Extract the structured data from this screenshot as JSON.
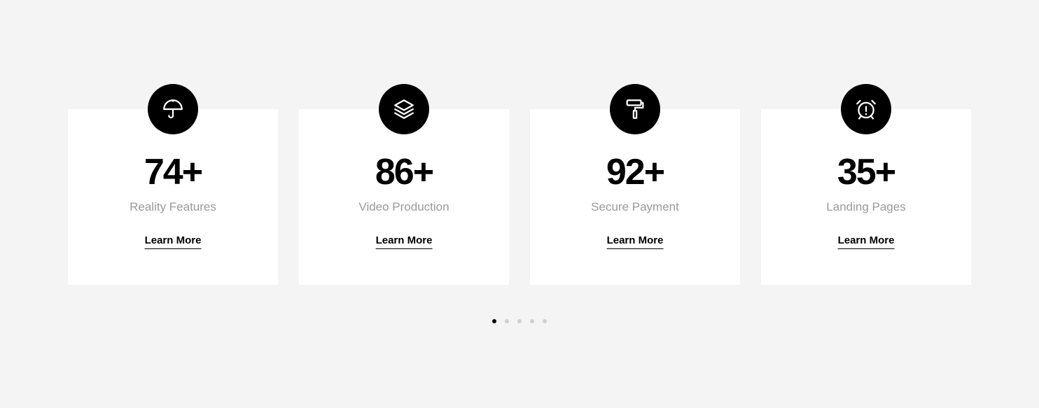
{
  "features": [
    {
      "icon": "umbrella-icon",
      "number": "74+",
      "label": "Reality Features",
      "link": "Learn More"
    },
    {
      "icon": "layers-icon",
      "number": "86+",
      "label": "Video Production",
      "link": "Learn More"
    },
    {
      "icon": "paint-roller-icon",
      "number": "92+",
      "label": "Secure Payment",
      "link": "Learn More"
    },
    {
      "icon": "alarm-clock-icon",
      "number": "35+",
      "label": "Landing Pages",
      "link": "Learn More"
    }
  ],
  "pager": {
    "count": 5,
    "active_index": 0
  },
  "colors": {
    "background": "#f4f4f4",
    "card": "#ffffff",
    "accent": "#000000",
    "muted_text": "#9a9a9a",
    "inactive_dot": "#cfcfcf"
  }
}
